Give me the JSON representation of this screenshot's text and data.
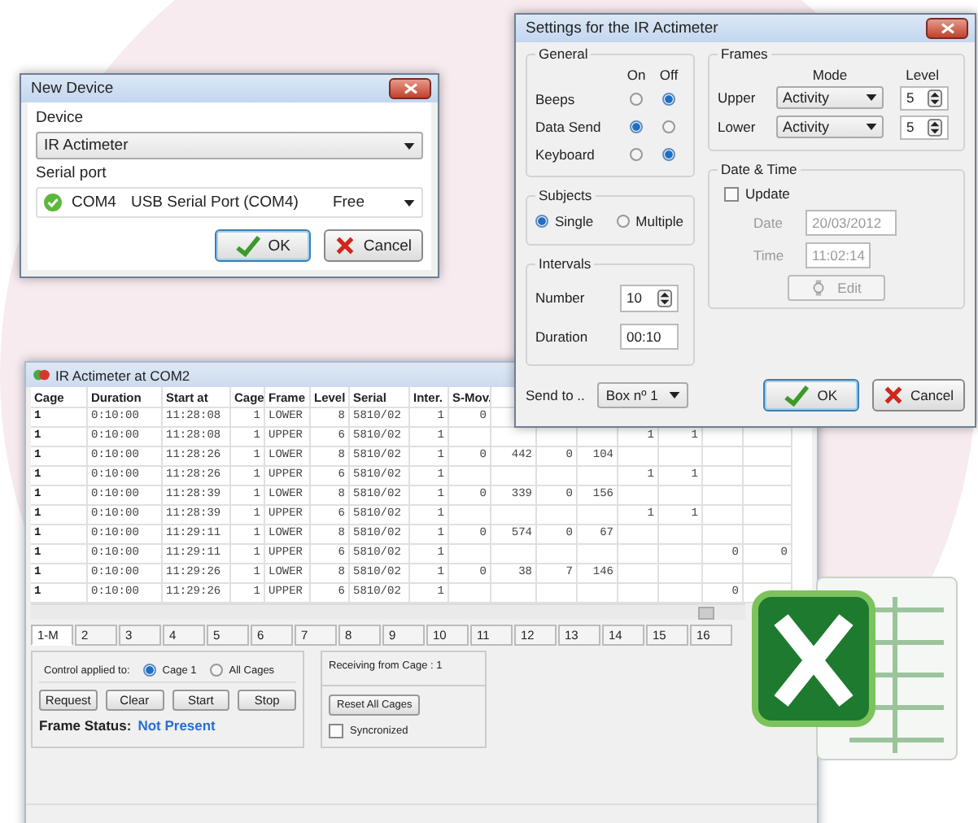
{
  "new_device_dialog": {
    "title": "New Device",
    "device_label": "Device",
    "device_value": "IR Actimeter",
    "serial_port_label": "Serial port",
    "port": {
      "name": "COM4",
      "description": "USB Serial Port (COM4)",
      "status": "Free"
    },
    "buttons": [
      {
        "label": "OK",
        "kind": "ok",
        "focused": true
      },
      {
        "label": "Cancel",
        "kind": "cancel",
        "focused": false
      }
    ]
  },
  "settings_dialog": {
    "title": "Settings for the IR Actimeter",
    "general": {
      "title": "General",
      "on_header": "On",
      "off_header": "Off",
      "options": [
        {
          "label": "Beeps",
          "on": false
        },
        {
          "label": "Data Send",
          "on": true
        },
        {
          "label": "Keyboard",
          "on": false
        }
      ]
    },
    "frames": {
      "title": "Frames",
      "mode_header": "Mode",
      "level_header": "Level",
      "rows": [
        {
          "label": "Upper",
          "mode": "Activity",
          "level_value": "5"
        },
        {
          "label": "Lower",
          "mode": "Activity",
          "level_value": "5"
        }
      ]
    },
    "subjects": {
      "title": "Subjects",
      "options": [
        {
          "label": "Single",
          "selected": true
        },
        {
          "label": "Multiple",
          "selected": false
        }
      ]
    },
    "date_time": {
      "title": "Date & Time",
      "update_label": "Update",
      "update_checked": false,
      "disabled": true,
      "date_label": "Date",
      "date": "20/03/2012",
      "time_label": "Time",
      "time": "11:02:14",
      "edit_button": "Edit"
    },
    "intervals": {
      "title": "Intervals",
      "number_label": "Number",
      "number": "10",
      "duration_label": "Duration",
      "duration": "00:10"
    },
    "send_to_label": "Send to ..",
    "send_to": "Box nº 1",
    "buttons": [
      {
        "label": "OK",
        "kind": "ok",
        "focused": true
      },
      {
        "label": "Cancel",
        "kind": "cancel",
        "focused": false
      }
    ]
  },
  "main_window": {
    "title": "IR Actimeter at COM2",
    "table": {
      "columns": [
        "Cage",
        "Duration",
        "Start at",
        "Cage",
        "Frame",
        "Level",
        "Serial",
        "Inter.",
        "S-Mov."
      ],
      "rows": [
        {
          "cage": "1",
          "duration": "0:10:00",
          "start_at": "11:28:08",
          "cage_2": "1",
          "frame": "LOWER",
          "level": "8",
          "serial": "5810/02",
          "inter": "1",
          "s_mov": "0"
        },
        {
          "cage": "1",
          "duration": "0:10:00",
          "start_at": "11:28:08",
          "cage_2": "1",
          "frame": "UPPER",
          "level": "6",
          "serial": "5810/02",
          "inter": "1",
          "column_13": "1",
          "column_14": "1"
        },
        {
          "cage": "1",
          "duration": "0:10:00",
          "start_at": "11:28:26",
          "cage_2": "1",
          "frame": "LOWER",
          "level": "8",
          "serial": "5810/02",
          "inter": "1",
          "s_mov": "0",
          "column_10": "442",
          "column_11": "0",
          "column_12": "104"
        },
        {
          "cage": "1",
          "duration": "0:10:00",
          "start_at": "11:28:26",
          "cage_2": "1",
          "frame": "UPPER",
          "level": "6",
          "serial": "5810/02",
          "inter": "1",
          "column_13": "1",
          "column_14": "1"
        },
        {
          "cage": "1",
          "duration": "0:10:00",
          "start_at": "11:28:39",
          "cage_2": "1",
          "frame": "LOWER",
          "level": "8",
          "serial": "5810/02",
          "inter": "1",
          "s_mov": "0",
          "column_10": "339",
          "column_11": "0",
          "column_12": "156"
        },
        {
          "cage": "1",
          "duration": "0:10:00",
          "start_at": "11:28:39",
          "cage_2": "1",
          "frame": "UPPER",
          "level": "6",
          "serial": "5810/02",
          "inter": "1",
          "column_13": "1",
          "column_14": "1"
        },
        {
          "cage": "1",
          "duration": "0:10:00",
          "start_at": "11:29:11",
          "cage_2": "1",
          "frame": "LOWER",
          "level": "8",
          "serial": "5810/02",
          "inter": "1",
          "s_mov": "0",
          "column_10": "574",
          "column_11": "0",
          "column_12": "67"
        },
        {
          "cage": "1",
          "duration": "0:10:00",
          "start_at": "11:29:11",
          "cage_2": "1",
          "frame": "UPPER",
          "level": "6",
          "serial": "5810/02",
          "inter": "1",
          "column_15": "0",
          "column_16": "0"
        },
        {
          "cage": "1",
          "duration": "0:10:00",
          "start_at": "11:29:26",
          "cage_2": "1",
          "frame": "LOWER",
          "level": "8",
          "serial": "5810/02",
          "inter": "1",
          "s_mov": "0",
          "column_10": "38",
          "column_11": "7",
          "column_12": "146"
        },
        {
          "cage": "1",
          "duration": "0:10:00",
          "start_at": "11:29:26",
          "cage_2": "1",
          "frame": "UPPER",
          "level": "6",
          "serial": "5810/02",
          "inter": "1",
          "column_15": "0"
        }
      ]
    },
    "tabs": [
      {
        "label": "1-M",
        "selected": true
      },
      {
        "label": "2",
        "selected": false
      },
      {
        "label": "3",
        "selected": false
      },
      {
        "label": "4",
        "selected": false
      },
      {
        "label": "5",
        "selected": false
      },
      {
        "label": "6",
        "selected": false
      },
      {
        "label": "7",
        "selected": false
      },
      {
        "label": "8",
        "selected": false
      },
      {
        "label": "9",
        "selected": false
      },
      {
        "label": "10",
        "selected": false
      },
      {
        "label": "11",
        "selected": false
      },
      {
        "label": "12",
        "selected": false
      },
      {
        "label": "13",
        "selected": false
      },
      {
        "label": "14",
        "selected": false
      },
      {
        "label": "15",
        "selected": false
      },
      {
        "label": "16",
        "selected": false
      }
    ],
    "control": {
      "label": "Control applied to:",
      "options": [
        {
          "label": "Cage 1",
          "selected": true
        },
        {
          "label": "All Cages",
          "selected": false
        }
      ],
      "buttons": [
        "Request",
        "Clear",
        "Start",
        "Stop"
      ],
      "frame_status_label": "Frame Status:",
      "frame_status": "Not Present"
    },
    "receiving": {
      "label": "Receiving from Cage : 1",
      "reset_button": "Reset All Cages",
      "sync_label": "Syncronized",
      "sync_checked": false
    }
  }
}
